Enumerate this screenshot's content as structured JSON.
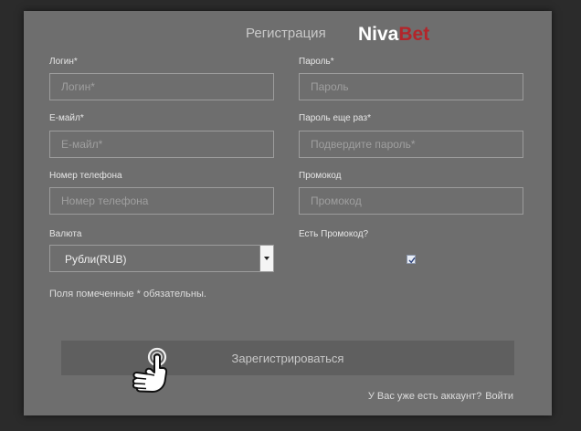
{
  "header": {
    "title": "Регистрация",
    "logo_part1": "Niva",
    "logo_part2": "Bet",
    "logo_colors": {
      "niva": "#ffffff",
      "bet": "#b3252a"
    }
  },
  "form": {
    "login": {
      "label": "Логин*",
      "placeholder": "Логин*"
    },
    "password": {
      "label": "Пароль*",
      "placeholder": "Пароль"
    },
    "email": {
      "label": "Е-майл*",
      "placeholder": "Е-майл*"
    },
    "password_repeat": {
      "label": "Пароль еще раз*",
      "placeholder": "Подвердите пароль*"
    },
    "phone": {
      "label": "Номер телефона",
      "placeholder": "Номер телефона"
    },
    "promo": {
      "label": "Промокод",
      "placeholder": "Промокод"
    },
    "currency": {
      "label": "Валюта",
      "selected": "Рубли(RUB)"
    },
    "has_promo": {
      "label": "Есть Промокод?",
      "checked": true
    },
    "required_note": "Поля помеченные * обязательны.",
    "submit_label": "Зарегистрироваться",
    "have_account_text": "У Вас уже есть аккаунт?",
    "login_link": "Войти"
  },
  "cursor_icon": "hand-pointer-icon"
}
